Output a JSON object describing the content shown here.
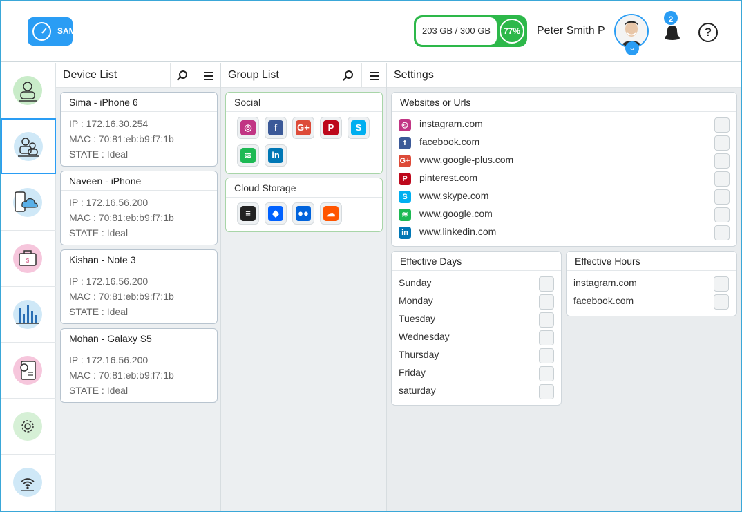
{
  "header": {
    "logo_text": "SAMPLE",
    "storage_text": "203 GB / 300 GB",
    "storage_percent": "77%",
    "storage_fraction": 0.77,
    "username": "Peter Smith P",
    "notification_count": "2",
    "help_label": "?"
  },
  "sidebar": {
    "items": [
      {
        "icon": "user-icon",
        "color": "#c9ecc9"
      },
      {
        "icon": "users-icon",
        "color": "#cfe8f7"
      },
      {
        "icon": "device-cloud-icon",
        "color": "#cfe8f7"
      },
      {
        "icon": "briefcase-icon",
        "color": "#f6c6dc"
      },
      {
        "icon": "bar-chart-icon",
        "color": "#cfe8f7"
      },
      {
        "icon": "settings-document-icon",
        "color": "#f6c6dc"
      },
      {
        "icon": "gear-icon",
        "color": "#d6f0d6"
      },
      {
        "icon": "wifi-icon",
        "color": "#cfe8f7"
      }
    ]
  },
  "devices": {
    "title": "Device List",
    "items": [
      {
        "name": "Sima - iPhone 6",
        "ip": "IP : 172.16.30.254",
        "mac": "MAC : 70:81:eb:b9:f7:1b",
        "state": "STATE : Ideal"
      },
      {
        "name": "Naveen - iPhone",
        "ip": "IP : 172.16.56.200",
        "mac": "MAC : 70:81:eb:b9:f7:1b",
        "state": "STATE : Ideal"
      },
      {
        "name": "Kishan - Note 3",
        "ip": "IP : 172.16.56.200",
        "mac": "MAC : 70:81:eb:b9:f7:1b",
        "state": "STATE : Ideal"
      },
      {
        "name": "Mohan - Galaxy S5",
        "ip": "IP : 172.16.56.200",
        "mac": "MAC : 70:81:eb:b9:f7:1b",
        "state": "STATE : Ideal"
      }
    ]
  },
  "groups": {
    "title": "Group List",
    "social": {
      "title": "Social",
      "icons": [
        {
          "name": "instagram-icon",
          "glyph": "◎",
          "color": "#c13584"
        },
        {
          "name": "facebook-icon",
          "glyph": "f",
          "color": "#3b5998"
        },
        {
          "name": "google-plus-icon",
          "glyph": "G+",
          "color": "#dd4b39"
        },
        {
          "name": "pinterest-icon",
          "glyph": "P",
          "color": "#bd081c"
        },
        {
          "name": "skype-icon",
          "glyph": "S",
          "color": "#00aff0"
        },
        {
          "name": "spotify-icon",
          "glyph": "≋",
          "color": "#1db954"
        },
        {
          "name": "linkedin-icon",
          "glyph": "in",
          "color": "#0077b5"
        }
      ]
    },
    "cloud": {
      "title": "Cloud Storage",
      "icons": [
        {
          "name": "buffer-icon",
          "glyph": "≡",
          "color": "#222222"
        },
        {
          "name": "dropbox-icon",
          "glyph": "◆",
          "color": "#0061ff"
        },
        {
          "name": "flickr-icon",
          "glyph": "●●",
          "color": "#0063dc"
        },
        {
          "name": "soundcloud-icon",
          "glyph": "☁",
          "color": "#ff5500"
        }
      ]
    }
  },
  "settings": {
    "title": "Settings",
    "websites": {
      "title": "Websites or Urls",
      "items": [
        {
          "label": "instagram.com",
          "icon": "instagram-icon",
          "glyph": "◎",
          "color": "#c13584"
        },
        {
          "label": "facebook.com",
          "icon": "facebook-icon",
          "glyph": "f",
          "color": "#3b5998"
        },
        {
          "label": "www.google-plus.com",
          "icon": "google-plus-icon",
          "glyph": "G+",
          "color": "#dd4b39"
        },
        {
          "label": "pinterest.com",
          "icon": "pinterest-icon",
          "glyph": "P",
          "color": "#bd081c"
        },
        {
          "label": "www.skype.com",
          "icon": "skype-icon",
          "glyph": "S",
          "color": "#00aff0"
        },
        {
          "label": "www.google.com",
          "icon": "spotify-icon",
          "glyph": "≋",
          "color": "#1db954"
        },
        {
          "label": "www.linkedin.com",
          "icon": "linkedin-icon",
          "glyph": "in",
          "color": "#0077b5"
        }
      ]
    },
    "days": {
      "title": "Effective Days",
      "items": [
        "Sunday",
        "Monday",
        "Tuesday",
        "Wednesday",
        "Thursday",
        "Friday",
        "saturday"
      ]
    },
    "hours": {
      "title": "Effective Hours",
      "items": [
        "instagram.com",
        "facebook.com"
      ]
    }
  }
}
